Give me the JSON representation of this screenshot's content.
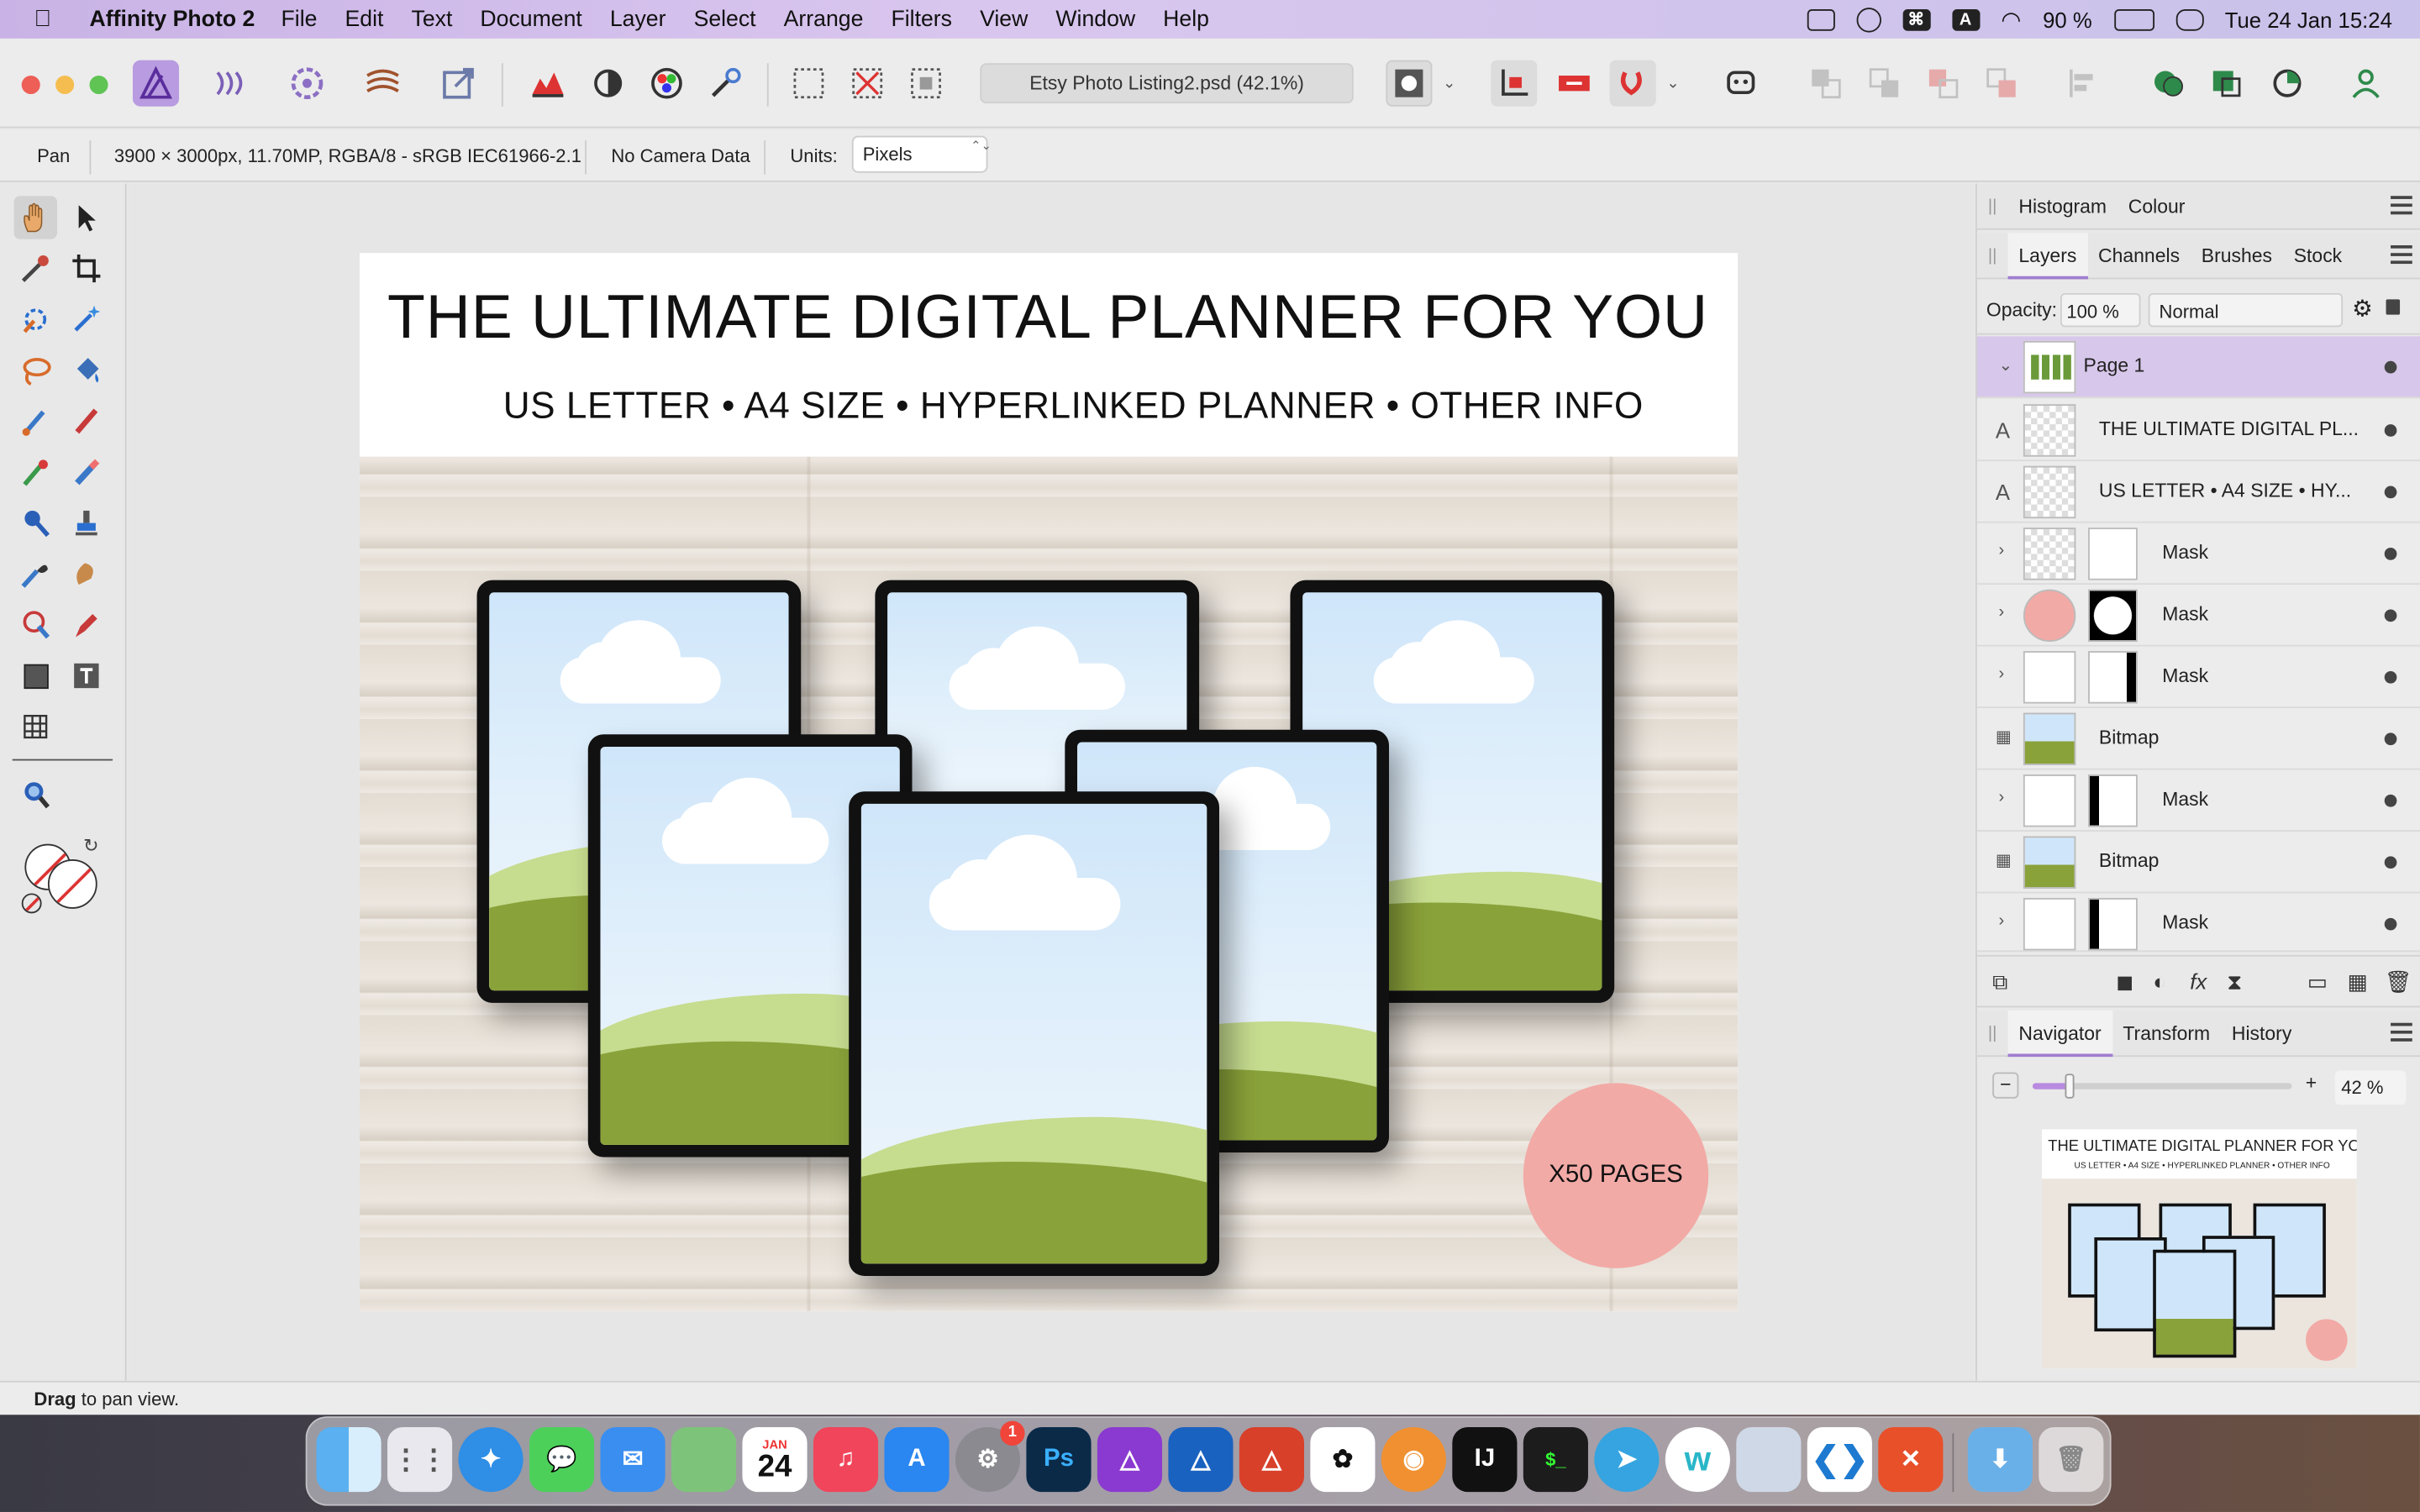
{
  "menubar": {
    "app_name": "Affinity Photo 2",
    "items": [
      "File",
      "Edit",
      "Text",
      "Document",
      "Layer",
      "Select",
      "Arrange",
      "Filters",
      "View",
      "Window",
      "Help"
    ],
    "battery": "90 %",
    "datetime": "Tue 24 Jan  15:24"
  },
  "toolbar": {
    "document_title": "Etsy Photo Listing2.psd (42.1%)"
  },
  "context_bar": {
    "tool": "Pan",
    "doc_info": "3900 × 3000px, 11.70MP, RGBA/8 - sRGB IEC61966-2.1",
    "camera": "No Camera Data",
    "units_label": "Units:",
    "units_value": "Pixels"
  },
  "document": {
    "title": "THE ULTIMATE DIGITAL PLANNER FOR YOU",
    "subtitle": "US LETTER • A4 SIZE • HYPERLINKED PLANNER • OTHER INFO",
    "badge": "X50 PAGES"
  },
  "panels": {
    "top_tabs": [
      "Histogram",
      "Colour"
    ],
    "layer_tabs": [
      "Layers",
      "Channels",
      "Brushes",
      "Stock"
    ],
    "opacity_label": "Opacity:",
    "opacity_value": "100 %",
    "blend_mode": "Normal",
    "layers": [
      {
        "name": "Page 1"
      },
      {
        "name": "THE ULTIMATE DIGITAL PL..."
      },
      {
        "name": "US LETTER • A4 SIZE • HY..."
      },
      {
        "name": "Mask"
      },
      {
        "name": "Mask"
      },
      {
        "name": "Mask"
      },
      {
        "name": "Bitmap"
      },
      {
        "name": "Mask"
      },
      {
        "name": "Bitmap"
      },
      {
        "name": "Mask"
      }
    ],
    "nav_tabs": [
      "Navigator",
      "Transform",
      "History"
    ],
    "zoom_value": "42 %",
    "zoom_fraction": 0.42,
    "thumb_title": "THE ULTIMATE DIGITAL PLANNER FOR YOU",
    "thumb_subtitle": "US LETTER • A4 SIZE • HYPERLINKED PLANNER • OTHER INFO"
  },
  "statusbar": {
    "bold": "Drag",
    "rest": " to pan view."
  },
  "dock": {
    "calendar_month": "JAN",
    "calendar_day": "24",
    "settings_badge": "1"
  },
  "colors": {
    "accent": "#a07dd0",
    "selected_layer": "#d7c7ea",
    "badge": "#f2aaa6"
  }
}
